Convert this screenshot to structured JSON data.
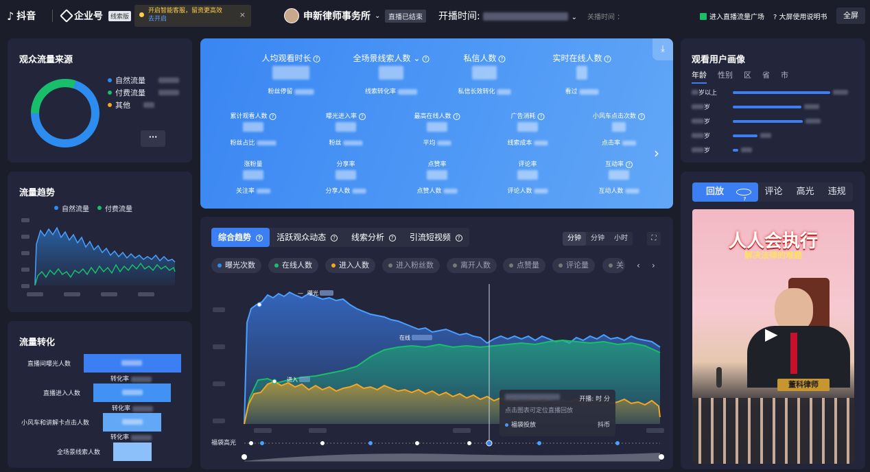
{
  "app": {
    "brand": "抖音",
    "enterprise": "企业号",
    "enterprise_badge": "线索版"
  },
  "notice": {
    "text": "开启智能客服，留资更高效",
    "link": "去开启",
    "close": "×"
  },
  "header": {
    "host_name": "申新律师事务所",
    "status": "直播已结束",
    "start_label": "开播时间:",
    "close_label": "关播时间 ：",
    "traffic_plaza": "进入直播流量广场",
    "big_screen_guide": "大屏使用说明书",
    "fullscreen": "全屏"
  },
  "audience_source": {
    "title": "观众流量来源",
    "legend": [
      {
        "label": "自然流量",
        "color": "#2d8cf0"
      },
      {
        "label": "付费流量",
        "color": "#19be6b"
      },
      {
        "label": "其他",
        "color": "#f5a623"
      }
    ],
    "more": "···",
    "donut_fractions": {
      "natural": 0.7,
      "paid": 0.3,
      "other": 0.0
    }
  },
  "traffic_trend": {
    "title": "流量趋势",
    "legend": [
      {
        "label": "自然流量",
        "color": "#2d8cf0"
      },
      {
        "label": "付费流量",
        "color": "#19be6b"
      }
    ]
  },
  "conversion": {
    "title": "流量转化",
    "steps": [
      "直播间曝光人数",
      "直播进入人数",
      "小风车和讲解卡点击人数",
      "全场景线索人数"
    ],
    "rate_label": "转化率"
  },
  "stats": {
    "row1": [
      {
        "label": "人均观看时长",
        "sub": "粉丝停留"
      },
      {
        "label": "全场景线索人数",
        "sub": "线索转化率"
      },
      {
        "label": "私信人数",
        "sub": "私信长效转化"
      },
      {
        "label": "实时在线人数",
        "sub": "看过"
      }
    ],
    "row2": [
      {
        "label": "累计观看人数",
        "sub": "粉丝占比"
      },
      {
        "label": "曝光进入率",
        "sub": "粉丝"
      },
      {
        "label": "最高在线人数",
        "sub": "平均"
      },
      {
        "label": "广告消耗",
        "sub": "线索成本"
      },
      {
        "label": "小风车点击次数",
        "sub": "点击率"
      }
    ],
    "row3": [
      {
        "label": "涨粉量",
        "sub": "关注率"
      },
      {
        "label": "分享率",
        "sub": "分享人数"
      },
      {
        "label": "点赞率",
        "sub": "点赞人数"
      },
      {
        "label": "评论率",
        "sub": "评论人数"
      },
      {
        "label": "互动率",
        "sub": "互动人数"
      }
    ],
    "next": "›",
    "download": "download-icon"
  },
  "main_chart": {
    "tabs": [
      {
        "label": "综合趋势",
        "active": true
      },
      {
        "label": "活跃观众动态"
      },
      {
        "label": "线索分析"
      },
      {
        "label": "引流短视频"
      }
    ],
    "granularity": [
      "分钟",
      "分钟",
      "小时"
    ],
    "metrics": [
      {
        "label": "曝光次数",
        "color": "#2d8cf0",
        "on": true
      },
      {
        "label": "在线人数",
        "color": "#19be6b",
        "on": true
      },
      {
        "label": "进入人数",
        "color": "#f5a623",
        "on": true
      },
      {
        "label": "进入粉丝数",
        "color": "#888",
        "on": false
      },
      {
        "label": "离开人数",
        "color": "#888",
        "on": false
      },
      {
        "label": "点赞量",
        "color": "#888",
        "on": false
      },
      {
        "label": "评论量",
        "color": "#888",
        "on": false
      },
      {
        "label": "关",
        "color": "#888",
        "on": false
      }
    ],
    "series_labels": {
      "exposure": "曝光",
      "online": "在线",
      "enter": "进入"
    },
    "tooltip": {
      "start_label": "开播:",
      "time_units": "时  分",
      "hint": "点击图表可定位直播回放",
      "row_label": "福袋投放",
      "row_value": "抖币"
    },
    "highlight_label": "福袋高光"
  },
  "portrait": {
    "title": "观看用户画像",
    "tabs": [
      "年龄",
      "性别",
      "区",
      "省",
      "市"
    ],
    "age_rows": [
      {
        "label": "岁以上",
        "fraction": 0.95
      },
      {
        "label": "岁",
        "fraction": 0.67
      },
      {
        "label": "岁",
        "fraction": 0.68
      },
      {
        "label": "岁",
        "fraction": 0.24
      },
      {
        "label": "岁",
        "fraction": 0.05
      }
    ]
  },
  "replay": {
    "tabs": [
      "回放",
      "评论",
      "高光",
      "违规"
    ],
    "video_title": "人人会执行",
    "video_subtitle": "解决法律的难题",
    "name_plate": "董科律师"
  }
}
